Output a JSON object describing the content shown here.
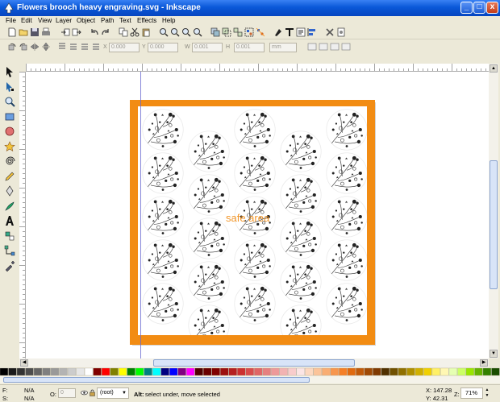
{
  "window": {
    "title": "Flowers brooch heavy engraving.svg - Inkscape",
    "minimize_glyph": "_",
    "maximize_glyph": "□",
    "close_glyph": "x"
  },
  "menubar": [
    "File",
    "Edit",
    "View",
    "Layer",
    "Object",
    "Path",
    "Text",
    "Effects",
    "Help"
  ],
  "command_bar_icons": [
    "new-document-icon",
    "open-folder-icon",
    "save-icon",
    "print-icon",
    "import-icon",
    "export-icon",
    "undo-icon",
    "redo-icon",
    "copy-icon",
    "cut-icon",
    "paste-icon",
    "zoom-selection-icon",
    "zoom-drawing-icon",
    "zoom-page-icon",
    "zoom-width-icon",
    "duplicate-icon",
    "clone-icon",
    "unlink-clone-icon",
    "group-icon",
    "ungroup-icon",
    "fill-stroke-icon",
    "text-font-icon",
    "xml-editor-icon",
    "align-distribute-icon",
    "preferences-icon",
    "document-properties-icon"
  ],
  "controls": {
    "x_value": "0.000",
    "y_value": "0.000",
    "w_label": "W",
    "w_value": "0.001",
    "h_label": "H",
    "h_value": "0.001",
    "unit": "mm"
  },
  "tools": [
    "selector-tool-icon",
    "node-tool-icon",
    "zoom-tool-icon",
    "rectangle-tool-icon",
    "ellipse-tool-icon",
    "star-tool-icon",
    "spiral-tool-icon",
    "pencil-tool-icon",
    "pen-tool-icon",
    "calligraphy-tool-icon",
    "text-tool-icon",
    "gradient-tool-icon",
    "connector-tool-icon",
    "dropper-tool-icon"
  ],
  "canvas": {
    "safe_area_label": "safe area",
    "frame_color": "#f28c13",
    "page_color": "#ffffff"
  },
  "status": {
    "fill_label": "F:",
    "fill_value": "N/A",
    "stroke_label": "S:",
    "stroke_value": "N/A",
    "opacity_label": "O:",
    "opacity_value": "0",
    "layer_value": "(root)",
    "message_bold": "Alt:",
    "message": "select under, move selected",
    "x_readout": "X: 147.28",
    "y_readout": "Y: 42.31",
    "zoom_label": "Z:",
    "zoom_value": "71%"
  },
  "colors": {
    "accent": "#f28c13",
    "titlebar": "#0a58d8"
  }
}
